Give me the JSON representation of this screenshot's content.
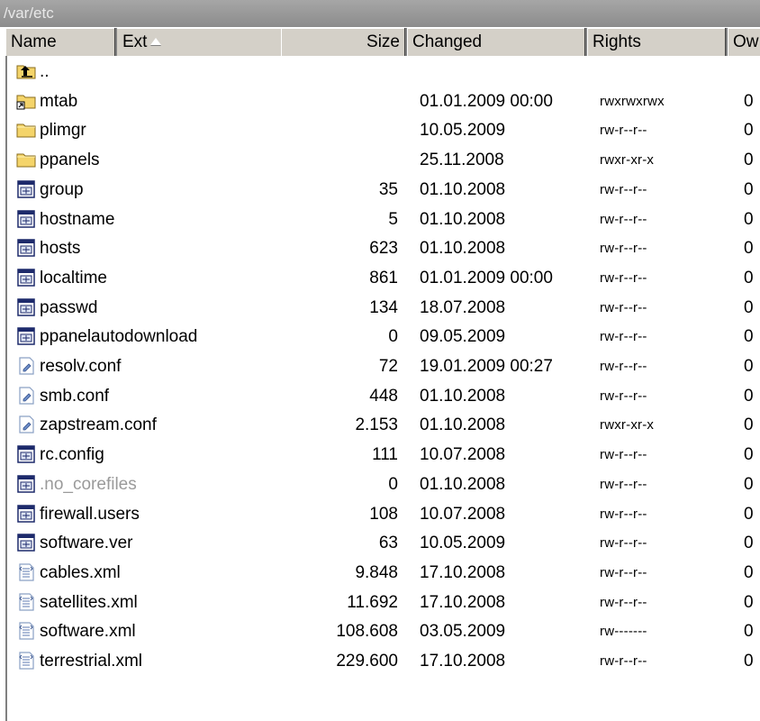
{
  "path": "/var/etc",
  "columns": {
    "name": "Name",
    "ext": "Ext",
    "size": "Size",
    "changed": "Changed",
    "rights": "Rights",
    "owner": "Ow"
  },
  "rows": [
    {
      "icon": "parent-folder-icon",
      "name": "..",
      "size": "",
      "changed": "",
      "rights": "",
      "owner": ""
    },
    {
      "icon": "folder-link-icon",
      "name": "mtab",
      "size": "",
      "changed": "01.01.2009 00:00",
      "rights": "rwxrwxrwx",
      "owner": "0"
    },
    {
      "icon": "folder-icon",
      "name": "plimgr",
      "size": "",
      "changed": "10.05.2009",
      "rights": "rw-r--r--",
      "owner": "0"
    },
    {
      "icon": "folder-icon",
      "name": "ppanels",
      "size": "",
      "changed": "25.11.2008",
      "rights": "rwxr-xr-x",
      "owner": "0"
    },
    {
      "icon": "binary-file-icon",
      "name": "group",
      "size": "35",
      "changed": "01.10.2008",
      "rights": "rw-r--r--",
      "owner": "0"
    },
    {
      "icon": "binary-file-icon",
      "name": "hostname",
      "size": "5",
      "changed": "01.10.2008",
      "rights": "rw-r--r--",
      "owner": "0"
    },
    {
      "icon": "binary-file-icon",
      "name": "hosts",
      "size": "623",
      "changed": "01.10.2008",
      "rights": "rw-r--r--",
      "owner": "0"
    },
    {
      "icon": "binary-file-icon",
      "name": "localtime",
      "size": "861",
      "changed": "01.01.2009 00:00",
      "rights": "rw-r--r--",
      "owner": "0"
    },
    {
      "icon": "binary-file-icon",
      "name": "passwd",
      "size": "134",
      "changed": "18.07.2008",
      "rights": "rw-r--r--",
      "owner": "0"
    },
    {
      "icon": "binary-file-icon",
      "name": "ppanelautodownload",
      "size": "0",
      "changed": "09.05.2009",
      "rights": "rw-r--r--",
      "owner": "0"
    },
    {
      "icon": "config-file-icon",
      "name": "resolv.conf",
      "size": "72",
      "changed": "19.01.2009 00:27",
      "rights": "rw-r--r--",
      "owner": "0"
    },
    {
      "icon": "config-file-icon",
      "name": "smb.conf",
      "size": "448",
      "changed": "01.10.2008",
      "rights": "rw-r--r--",
      "owner": "0"
    },
    {
      "icon": "config-file-icon",
      "name": "zapstream.conf",
      "size": "2.153",
      "changed": "01.10.2008",
      "rights": "rwxr-xr-x",
      "owner": "0"
    },
    {
      "icon": "binary-file-icon",
      "name": "rc.config",
      "size": "111",
      "changed": "10.07.2008",
      "rights": "rw-r--r--",
      "owner": "0"
    },
    {
      "icon": "binary-file-icon",
      "name": ".no_corefiles",
      "size": "0",
      "changed": "01.10.2008",
      "rights": "rw-r--r--",
      "owner": "0",
      "hidden": true
    },
    {
      "icon": "binary-file-icon",
      "name": "firewall.users",
      "size": "108",
      "changed": "10.07.2008",
      "rights": "rw-r--r--",
      "owner": "0"
    },
    {
      "icon": "binary-file-icon",
      "name": "software.ver",
      "size": "63",
      "changed": "10.05.2009",
      "rights": "rw-r--r--",
      "owner": "0"
    },
    {
      "icon": "xml-file-icon",
      "name": "cables.xml",
      "size": "9.848",
      "changed": "17.10.2008",
      "rights": "rw-r--r--",
      "owner": "0"
    },
    {
      "icon": "xml-file-icon",
      "name": "satellites.xml",
      "size": "11.692",
      "changed": "17.10.2008",
      "rights": "rw-r--r--",
      "owner": "0"
    },
    {
      "icon": "xml-file-icon",
      "name": "software.xml",
      "size": "108.608",
      "changed": "03.05.2009",
      "rights": "rw-------",
      "owner": "0"
    },
    {
      "icon": "xml-file-icon",
      "name": "terrestrial.xml",
      "size": "229.600",
      "changed": "17.10.2008",
      "rights": "rw-r--r--",
      "owner": "0"
    }
  ],
  "colors": {
    "pathbar": "#8c8c8c",
    "header": "#d4d0c8",
    "folder": "#f4d46a",
    "dim_text": "#9a9a9a"
  }
}
